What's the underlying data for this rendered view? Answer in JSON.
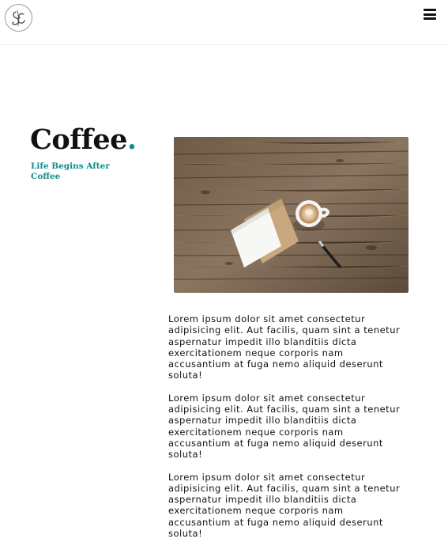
{
  "header": {
    "logo_icon": "monogram-logo",
    "menu_icon": "hamburger-menu-icon"
  },
  "hero": {
    "title": "Coffee",
    "title_dot": ".",
    "tagline": "Life Begins After Coffee",
    "accent_color": "#128b8b"
  },
  "image": {
    "description_icon": "coffee-table-photo"
  },
  "paragraphs": [
    "Lorem ipsum dolor sit amet consectetur adipisicing elit. Aut facilis, quam sint a tenetur aspernatur impedit illo blanditiis dicta exercitationem neque corporis nam accusantium at fuga nemo aliquid deserunt soluta!",
    "Lorem ipsum dolor sit amet consectetur adipisicing elit. Aut facilis, quam sint a tenetur aspernatur impedit illo blanditiis dicta exercitationem neque corporis nam accusantium at fuga nemo aliquid deserunt soluta!",
    "Lorem ipsum dolor sit amet consectetur adipisicing elit. Aut facilis, quam sint a tenetur aspernatur impedit illo blanditiis dicta exercitationem neque corporis nam accusantium at fuga nemo aliquid deserunt soluta!"
  ]
}
